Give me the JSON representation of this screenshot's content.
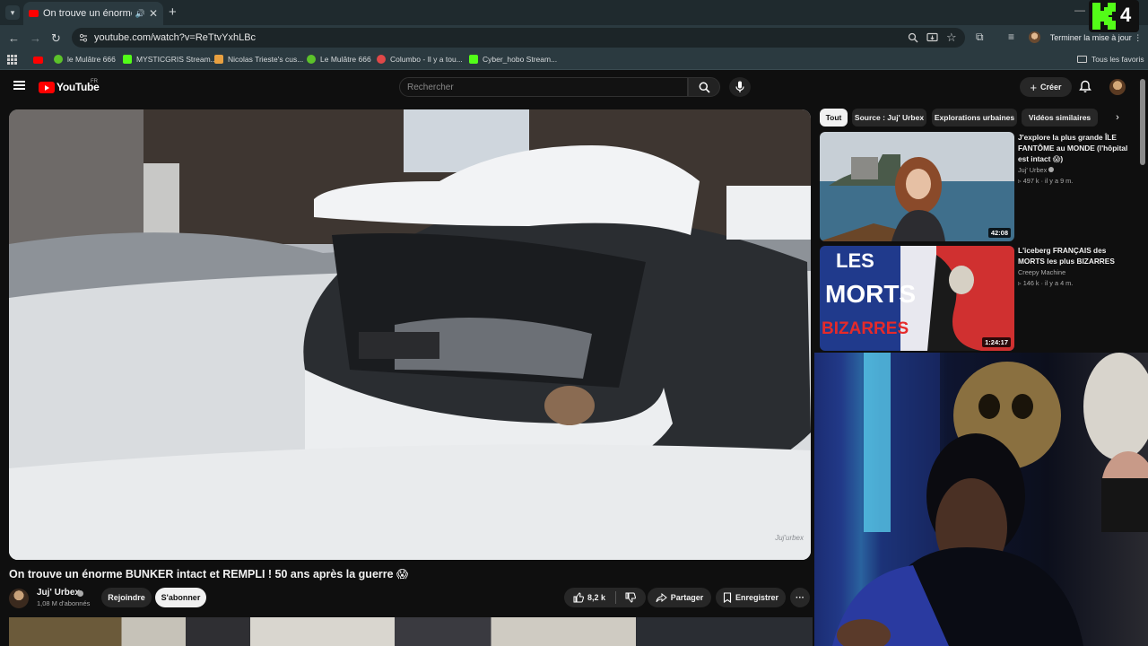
{
  "browser": {
    "tab_title": "On trouve un énorme BUNKER",
    "url": "youtube.com/watch?v=ReTtvYxhLBc",
    "update_label": "Terminer la mise à jour",
    "bookmarks": [
      {
        "label": "le Mulâtre 666",
        "color": "#5cc22a"
      },
      {
        "label": "MYSTICGRIS Stream...",
        "color": "#53fc18"
      },
      {
        "label": "Nicolas Trieste's cus...",
        "color": "#e8a040"
      },
      {
        "label": "Le Mulâtre 666",
        "color": "#5cc22a"
      },
      {
        "label": "Columbo - Il y a tou...",
        "color": "#e04848"
      },
      {
        "label": "Cyber_hobo Stream...",
        "color": "#53fc18"
      }
    ],
    "all_bookmarks_label": "Tous les favoris"
  },
  "overlay": {
    "logo_text": "4"
  },
  "youtube": {
    "logo_text": "YouTube",
    "region": "FR",
    "search_placeholder": "Rechercher",
    "create_label": "Créer"
  },
  "video": {
    "title": "On trouve un énorme BUNKER intact et REMPLI ! 50 ans après la guerre 😱",
    "watermark": "Juj'urbex",
    "channel_name": "Juj' Urbex",
    "subscribers": "1,08 M d'abonnés",
    "join_label": "Rejoindre",
    "subscribe_label": "S'abonner",
    "likes": "8,2 k",
    "share_label": "Partager",
    "save_label": "Enregistrer"
  },
  "chips": [
    "Tout",
    "Source : Juj' Urbex",
    "Explorations urbaines",
    "Vidéos similaires"
  ],
  "recommendations": [
    {
      "title": "J'explore la plus grande ÎLE FANTÔME au MONDE (l'hôpital est intact 😱)",
      "channel": "Juj' Urbex",
      "meta": "497 k · il y a 9 m.",
      "duration": "42:08"
    },
    {
      "title": "L'iceberg FRANÇAIS des MORTS les plus BIZARRES",
      "channel": "Creepy Machine",
      "meta": "146 k · il y a 4 m.",
      "duration": "1:24:17",
      "thumb_text_1": "LES",
      "thumb_text_2": "MORTS",
      "thumb_text_3": "BIZARRES"
    }
  ],
  "colors": {
    "youtube_red": "#ff0000",
    "kick_green": "#53fc18",
    "bg": "#0f0f0f"
  }
}
